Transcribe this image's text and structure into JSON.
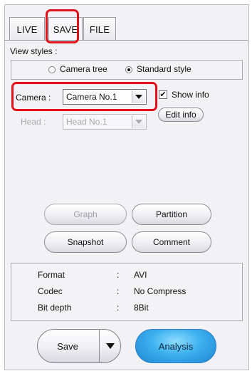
{
  "tabs": [
    {
      "label": "LIVE"
    },
    {
      "label": "SAVE"
    },
    {
      "label": "FILE"
    }
  ],
  "view_styles": {
    "label": "View styles :",
    "options": [
      {
        "label": "Camera tree",
        "selected": false
      },
      {
        "label": "Standard style",
        "selected": true
      }
    ]
  },
  "camera": {
    "label": "Camera :",
    "value": "Camera No.1",
    "show_info_label": "Show info",
    "show_info_checked": true,
    "edit_info_label": "Edit info"
  },
  "head": {
    "label": "Head :",
    "value": "Head No.1"
  },
  "buttons": {
    "graph": "Graph",
    "partition": "Partition",
    "snapshot": "Snapshot",
    "comment": "Comment"
  },
  "info": {
    "rows": [
      {
        "key": "Format",
        "sep": ":",
        "value": "AVI"
      },
      {
        "key": "Codec",
        "sep": ":",
        "value": "No Compress"
      },
      {
        "key": "Bit depth",
        "sep": ":",
        "value": "8Bit"
      }
    ]
  },
  "bottom": {
    "save_label": "Save",
    "analysis_label": "Analysis"
  },
  "colors": {
    "highlight": "#e3101a",
    "analysis_blue": "#3cb0ee"
  }
}
